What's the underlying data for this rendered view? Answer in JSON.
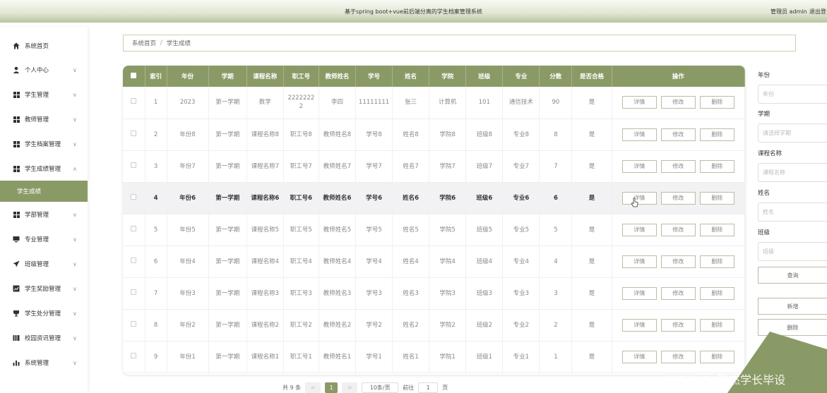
{
  "header": {
    "title": "基于spring boot+vue前后端分离的学生档案管理系统",
    "admin": "管理员 admin",
    "logout": "退出登"
  },
  "sidebar": {
    "items": [
      {
        "label": "系统首页",
        "icon": "home-icon"
      },
      {
        "label": "个人中心",
        "icon": "user-icon",
        "arrow": "∨"
      },
      {
        "label": "学生管理",
        "icon": "grid-icon",
        "arrow": "∨"
      },
      {
        "label": "教师管理",
        "icon": "grid-icon",
        "arrow": "∨"
      },
      {
        "label": "学生档案管理",
        "icon": "grid-icon",
        "arrow": "∨"
      },
      {
        "label": "学生成绩管理",
        "icon": "grid-icon",
        "arrow": "∧"
      },
      {
        "label": "学生成绩",
        "icon": "",
        "active": true
      },
      {
        "label": "学部管理",
        "icon": "grid-icon",
        "arrow": "∨"
      },
      {
        "label": "专业管理",
        "icon": "monitor-icon",
        "arrow": "∨"
      },
      {
        "label": "班级管理",
        "icon": "send-icon",
        "arrow": "∨"
      },
      {
        "label": "学生奖励管理",
        "icon": "chart-icon",
        "arrow": "∨"
      },
      {
        "label": "学生处分管理",
        "icon": "trophy-icon",
        "arrow": "∨"
      },
      {
        "label": "校园资讯管理",
        "icon": "bars-icon",
        "arrow": "∨"
      },
      {
        "label": "系统管理",
        "icon": "stats-icon",
        "arrow": "∨"
      }
    ]
  },
  "breadcrumb": {
    "home": "系统首页",
    "sep": "/",
    "current": "学生成绩"
  },
  "table": {
    "headers": [
      "索引",
      "年份",
      "学期",
      "课程名称",
      "职工号",
      "教师姓名",
      "学号",
      "姓名",
      "学院",
      "班级",
      "专业",
      "分数",
      "是否合格",
      "操作"
    ],
    "rows": [
      {
        "idx": "1",
        "year": "2023",
        "term": "第一学期",
        "course": "数学",
        "staff": "22222222",
        "teacher": "李四",
        "sno": "11111111",
        "name": "张三",
        "college": "计算机",
        "class": "101",
        "major": "通信技术",
        "score": "90",
        "pass": "是"
      },
      {
        "idx": "2",
        "year": "年份8",
        "term": "第一学期",
        "course": "课程名称8",
        "staff": "职工号8",
        "teacher": "教师姓名8",
        "sno": "学号8",
        "name": "姓名8",
        "college": "学院8",
        "class": "班级8",
        "major": "专业8",
        "score": "8",
        "pass": "是"
      },
      {
        "idx": "3",
        "year": "年份7",
        "term": "第一学期",
        "course": "课程名称7",
        "staff": "职工号7",
        "teacher": "教师姓名7",
        "sno": "学号7",
        "name": "姓名7",
        "college": "学院7",
        "class": "班级7",
        "major": "专业7",
        "score": "7",
        "pass": "是"
      },
      {
        "idx": "4",
        "year": "年份6",
        "term": "第一学期",
        "course": "课程名称6",
        "staff": "职工号6",
        "teacher": "教师姓名6",
        "sno": "学号6",
        "name": "姓名6",
        "college": "学院6",
        "class": "班级6",
        "major": "专业6",
        "score": "6",
        "pass": "是"
      },
      {
        "idx": "5",
        "year": "年份5",
        "term": "第一学期",
        "course": "课程名称5",
        "staff": "职工号5",
        "teacher": "教师姓名5",
        "sno": "学号5",
        "name": "姓名5",
        "college": "学院5",
        "class": "班级5",
        "major": "专业5",
        "score": "5",
        "pass": "是"
      },
      {
        "idx": "6",
        "year": "年份4",
        "term": "第一学期",
        "course": "课程名称4",
        "staff": "职工号4",
        "teacher": "教师姓名4",
        "sno": "学号4",
        "name": "姓名4",
        "college": "学院4",
        "class": "班级4",
        "major": "专业4",
        "score": "4",
        "pass": "是"
      },
      {
        "idx": "7",
        "year": "年份3",
        "term": "第一学期",
        "course": "课程名称3",
        "staff": "职工号3",
        "teacher": "教师姓名3",
        "sno": "学号3",
        "name": "姓名3",
        "college": "学院3",
        "class": "班级3",
        "major": "专业3",
        "score": "3",
        "pass": "是"
      },
      {
        "idx": "8",
        "year": "年份2",
        "term": "第一学期",
        "course": "课程名称2",
        "staff": "职工号2",
        "teacher": "教师姓名2",
        "sno": "学号2",
        "name": "姓名2",
        "college": "学院2",
        "class": "班级2",
        "major": "专业2",
        "score": "2",
        "pass": "是"
      },
      {
        "idx": "9",
        "year": "年份1",
        "term": "第一学期",
        "course": "课程名称1",
        "staff": "职工号1",
        "teacher": "教师姓名1",
        "sno": "学号1",
        "name": "姓名1",
        "college": "学院1",
        "class": "班级1",
        "major": "专业1",
        "score": "1",
        "pass": "是"
      }
    ],
    "actions": {
      "detail": "详情",
      "edit": "修改",
      "delete": "删除"
    }
  },
  "pagination": {
    "total": "共 9 条",
    "prev": "<",
    "current": "1",
    "next": ">",
    "page_size": "10条/页",
    "goto": "前往",
    "goto_value": "1",
    "page_unit": "页"
  },
  "filters": {
    "year": {
      "label": "年份",
      "placeholder": "年份"
    },
    "term": {
      "label": "学期",
      "placeholder": "请选择学期"
    },
    "course": {
      "label": "课程名称",
      "placeholder": "课程名称"
    },
    "name": {
      "label": "姓名",
      "placeholder": "姓名"
    },
    "class": {
      "label": "班级",
      "placeholder": "班级"
    },
    "query_label": "查询",
    "add_label": "新增",
    "delete_label": "删除"
  },
  "watermark": "CSDN @x陈杰学长毕设",
  "colors": {
    "accent": "#8a9a66",
    "header_gradient_end": "#b9c4a0"
  }
}
